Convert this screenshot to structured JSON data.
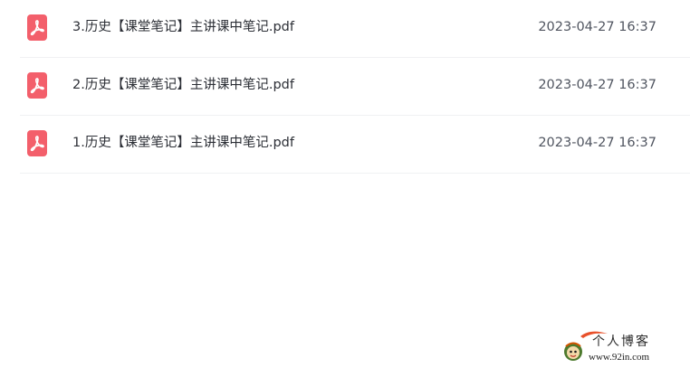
{
  "files": [
    {
      "name": "3.历史【课堂笔记】主讲课中笔记.pdf",
      "date": "2023-04-27 16:37",
      "icon": "pdf-icon"
    },
    {
      "name": "2.历史【课堂笔记】主讲课中笔记.pdf",
      "date": "2023-04-27 16:37",
      "icon": "pdf-icon"
    },
    {
      "name": "1.历史【课堂笔记】主讲课中笔记.pdf",
      "date": "2023-04-27 16:37",
      "icon": "pdf-icon"
    }
  ],
  "watermark": {
    "title": "个人博客",
    "url": "www.92in.com"
  },
  "colors": {
    "pdf_icon": "#f35f6b",
    "row_divider": "#f0f1f3",
    "filename_text": "#2c2f36",
    "date_text": "#505560"
  }
}
